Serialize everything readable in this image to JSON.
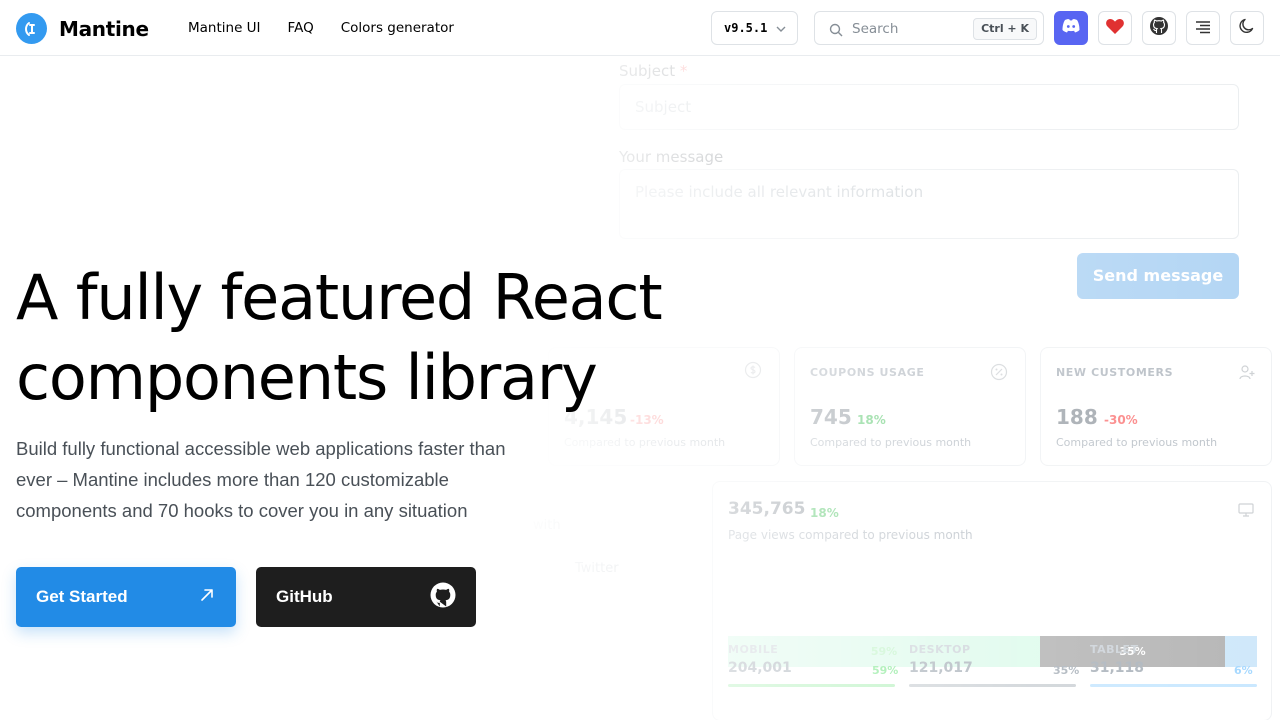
{
  "header": {
    "logo_text": "Mantine",
    "nav": [
      "Mantine UI",
      "FAQ",
      "Colors generator"
    ],
    "version": "v9.5.1",
    "search_placeholder": "Search",
    "search_shortcut": "Ctrl + K",
    "icons": [
      "discord-icon",
      "heart-icon",
      "github-icon",
      "table-of-contents-icon",
      "moon-icon"
    ],
    "discord_color": "#5865f2",
    "heart_color": "#e03131"
  },
  "hero": {
    "title_line1": "A fully featured React",
    "title_line2": "components library",
    "description": "Build fully functional accessible web applications faster than ever – Mantine includes more than 120 customizable components and 70 hooks to cover you in any situation",
    "primary_button": "Get Started",
    "secondary_button": "GitHub",
    "primary_color": "#228be6"
  },
  "demo": {
    "form": {
      "subject_label": "Subject",
      "required_mark": "*",
      "subject_placeholder": "Subject",
      "message_label": "Your message",
      "message_placeholder": "Please include all relevant information",
      "send_button": "Send message"
    },
    "stats": [
      {
        "title": "",
        "value": "4,145",
        "diff": "-13%",
        "sub": "Compared to previous month"
      },
      {
        "title": "COUPONS USAGE",
        "value": "745",
        "diff": "18%",
        "sub": "Compared to previous month"
      },
      {
        "title": "NEW CUSTOMERS",
        "value": "188",
        "diff": "-30%",
        "sub": "Compared to previous month"
      }
    ],
    "page_views": {
      "value": "345,765",
      "diff": "18%",
      "sub": "Page views compared to previous month",
      "segments": [
        {
          "label": "59%",
          "value": 59,
          "color": "#d3f9e6"
        },
        {
          "label": "35%",
          "value": 35,
          "color": "#9e9e9e"
        },
        {
          "label": "",
          "value": 6,
          "color": "#bfe0f8"
        }
      ],
      "devices": [
        {
          "label": "MOBILE",
          "count": "204,001",
          "pct": "59%",
          "color": "#8ce99a"
        },
        {
          "label": "DESKTOP",
          "count": "121,017",
          "pct": "35%",
          "color": "#adb5bd"
        },
        {
          "label": "TABLET",
          "count": "31,118",
          "pct": "6%",
          "color": "#a5d8ff"
        }
      ]
    },
    "social_fragment": "Twitter",
    "fragment_left": "with"
  }
}
